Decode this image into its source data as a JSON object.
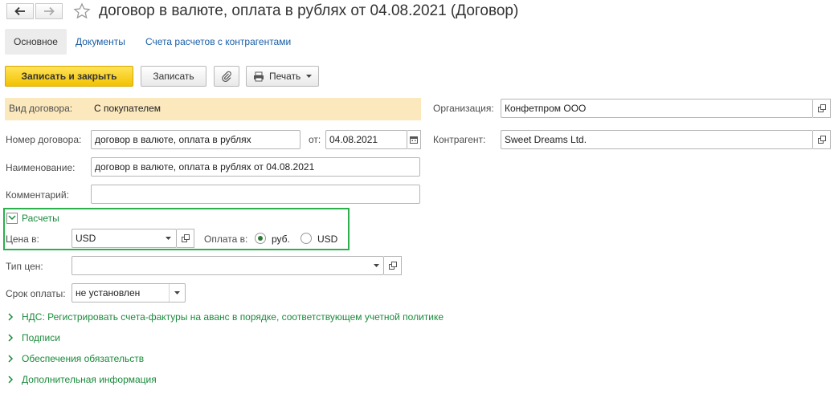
{
  "window": {
    "title": "договор в валюте, оплата в рублях от 04.08.2021 (Договор)"
  },
  "tabs": [
    {
      "label": "Основное"
    },
    {
      "label": "Документы"
    },
    {
      "label": "Счета расчетов с контрагентами"
    }
  ],
  "toolbar": {
    "save_close_label": "Записать и закрыть",
    "save_label": "Записать",
    "print_label": "Печать"
  },
  "form": {
    "contract_kind": {
      "label": "Вид договора:",
      "value": "С покупателем"
    },
    "organization": {
      "label": "Организация:",
      "value": "Конфетпром ООО"
    },
    "contract_number": {
      "label": "Номер договора:",
      "value": "договор в валюте, оплата в рублях"
    },
    "date": {
      "label": "от:",
      "value": "04.08.2021"
    },
    "counterparty": {
      "label": "Контрагент:",
      "value": "Sweet Dreams Ltd."
    },
    "name": {
      "label": "Наименование:",
      "value": "договор в валюте, оплата в рублях от 04.08.2021"
    },
    "comment": {
      "label": "Комментарий:",
      "value": ""
    },
    "settlements": {
      "title": "Расчеты",
      "price_label": "Цена в:",
      "price_value": "USD",
      "payment_label": "Оплата в:",
      "options": [
        {
          "label": "руб.",
          "checked": true
        },
        {
          "label": "USD",
          "checked": false
        }
      ]
    },
    "price_type": {
      "label": "Тип цен:",
      "value": ""
    },
    "payment_term": {
      "label": "Срок оплаты:",
      "value": "не установлен"
    }
  },
  "sections": [
    {
      "label": "НДС: Регистрировать счета-фактуры на аванс в порядке, соответствующем учетной политике"
    },
    {
      "label": "Подписи"
    },
    {
      "label": "Обеспечения обязательств"
    },
    {
      "label": "Дополнительная информация"
    }
  ]
}
